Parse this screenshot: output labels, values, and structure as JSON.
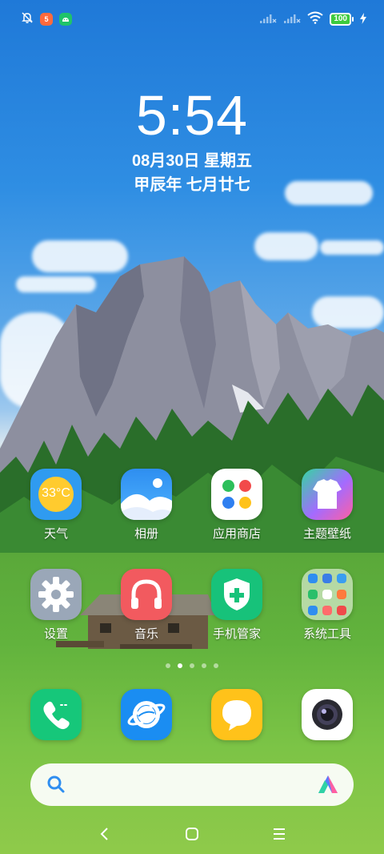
{
  "status_bar": {
    "left_icons": [
      "bell-off-icon",
      "app-notification-icon",
      "android-icon"
    ],
    "notification_badge": "5",
    "battery_level": "100",
    "right_icons": [
      "signal-icon",
      "signal-icon",
      "wifi-icon",
      "battery-icon",
      "charging-icon"
    ]
  },
  "clock": {
    "time": "5:54",
    "date": "08月30日 星期五",
    "lunar": "甲辰年 七月廿七"
  },
  "apps_row1": [
    {
      "label": "天气",
      "icon": "weather-icon",
      "temp": "33°C"
    },
    {
      "label": "相册",
      "icon": "gallery-icon"
    },
    {
      "label": "应用商店",
      "icon": "app-store-icon"
    },
    {
      "label": "主题壁纸",
      "icon": "themes-icon"
    }
  ],
  "apps_row2": [
    {
      "label": "设置",
      "icon": "settings-icon"
    },
    {
      "label": "音乐",
      "icon": "music-icon"
    },
    {
      "label": "手机管家",
      "icon": "security-icon"
    },
    {
      "label": "系统工具",
      "icon": "folder-icon"
    }
  ],
  "page_indicator": {
    "count": 5,
    "active_index": 1
  },
  "dock": [
    {
      "icon": "phone-icon"
    },
    {
      "icon": "browser-icon"
    },
    {
      "icon": "messages-icon"
    },
    {
      "icon": "camera-icon"
    }
  ],
  "search_bar": {
    "left_icon": "search-icon",
    "right_icon": "assistant-icon"
  },
  "nav_bar": [
    "back-icon",
    "home-icon",
    "menu-icon"
  ],
  "colors": {
    "weather": "#2f9bf0",
    "music": "#f25a5f",
    "security": "#17c27a",
    "phone": "#16c77a",
    "browser": "#1a8df2",
    "messages": "#ffc21a"
  }
}
